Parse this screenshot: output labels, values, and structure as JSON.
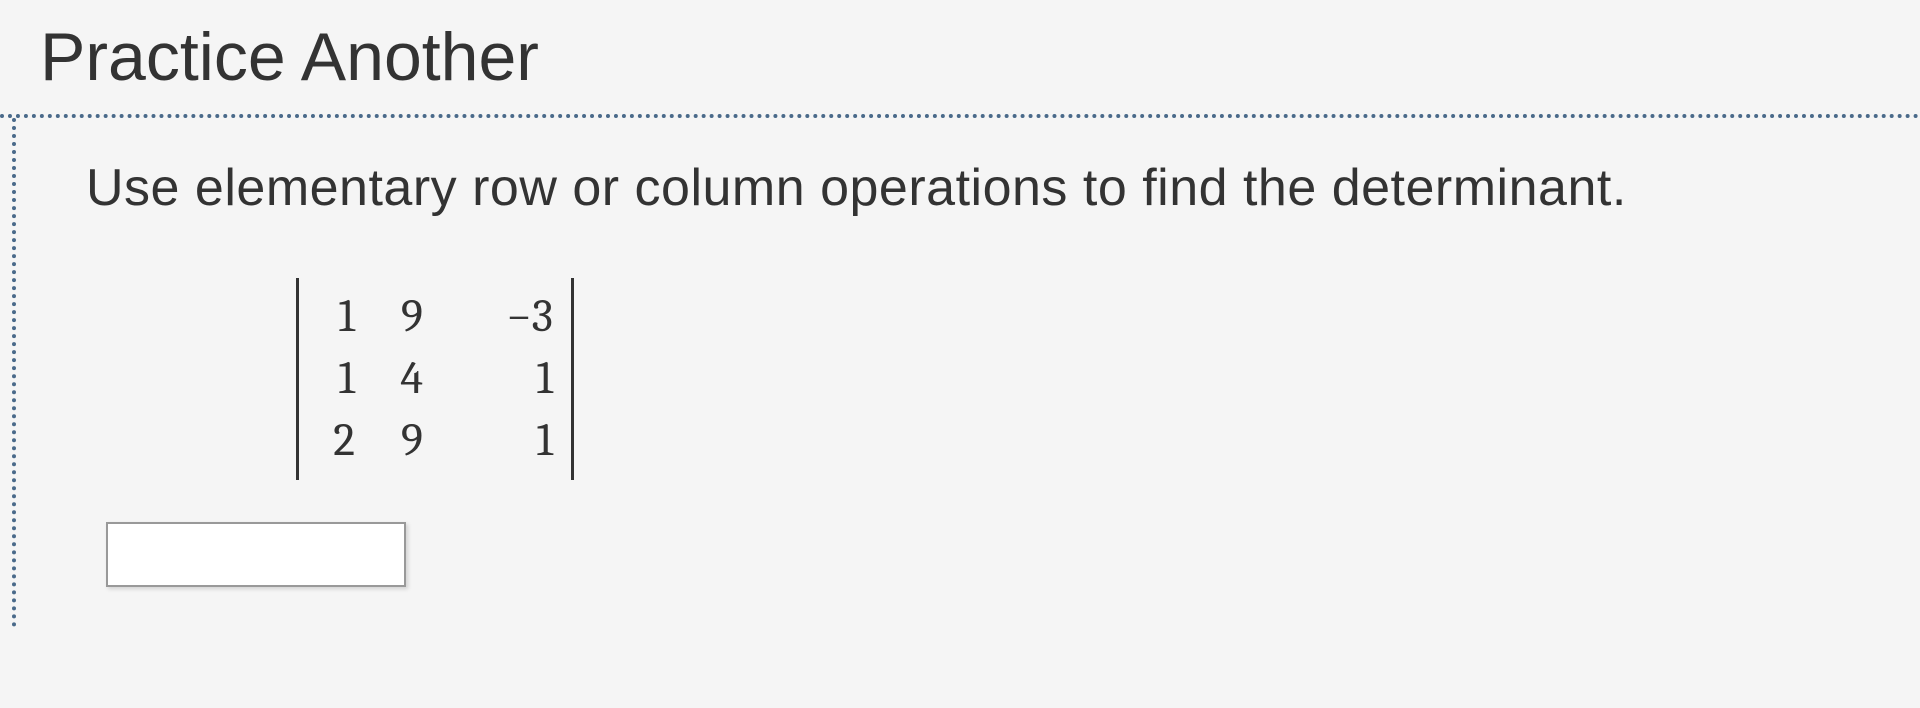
{
  "header": {
    "title": "Practice Another"
  },
  "question": {
    "instruction": "Use elementary row or column operations to find the determinant.",
    "matrix": {
      "rows": [
        {
          "c1": "1",
          "c2": "9",
          "c3": "−3"
        },
        {
          "c1": "1",
          "c2": "4",
          "c3": "1"
        },
        {
          "c1": "2",
          "c2": "9",
          "c3": "1"
        }
      ]
    },
    "answer": ""
  }
}
